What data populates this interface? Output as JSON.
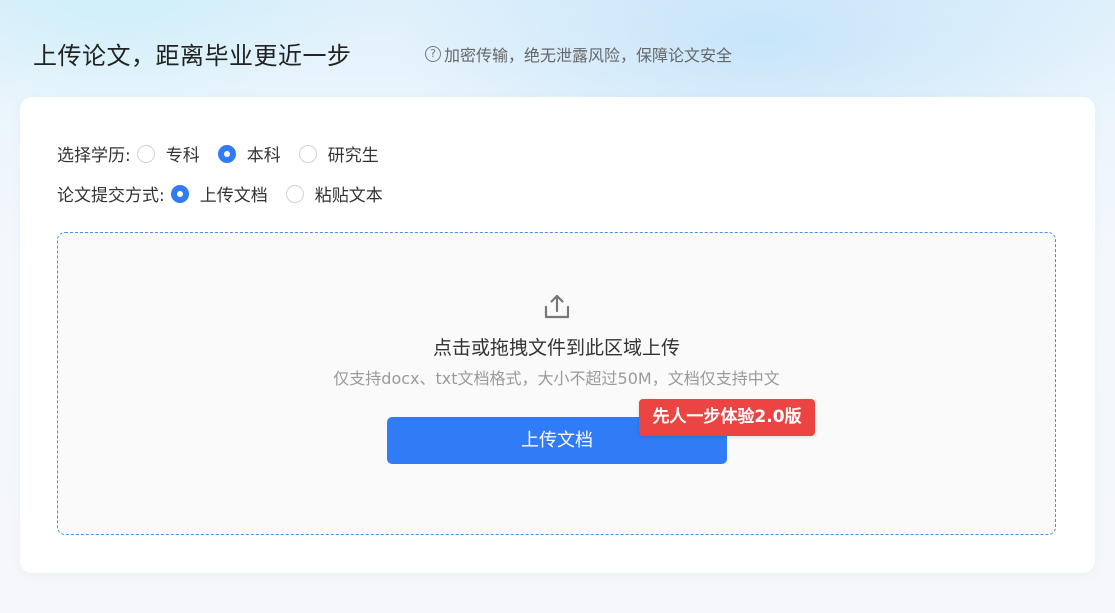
{
  "header": {
    "title": "上传论文，距离毕业更近一步",
    "notice": "加密传输，绝无泄露风险，保障论文安全",
    "notice_icon": "question-circle-icon"
  },
  "form": {
    "education": {
      "label": "选择学历:",
      "options": [
        {
          "label": "专科",
          "checked": false
        },
        {
          "label": "本科",
          "checked": true
        },
        {
          "label": "研究生",
          "checked": false
        }
      ]
    },
    "submit_method": {
      "label": "论文提交方式:",
      "options": [
        {
          "label": "上传文档",
          "checked": true
        },
        {
          "label": "粘贴文本",
          "checked": false
        }
      ]
    }
  },
  "upload": {
    "icon": "upload-icon",
    "main_text": "点击或拖拽文件到此区域上传",
    "sub_text": "仅支持docx、txt文档格式，大小不超过50M，文档仅支持中文",
    "button_label": "上传文档",
    "badge_text": "先人一步体验2.0版"
  },
  "colors": {
    "primary": "#2f7cf6",
    "badge": "#ec4343",
    "dropzone_border": "#4a90e2"
  }
}
